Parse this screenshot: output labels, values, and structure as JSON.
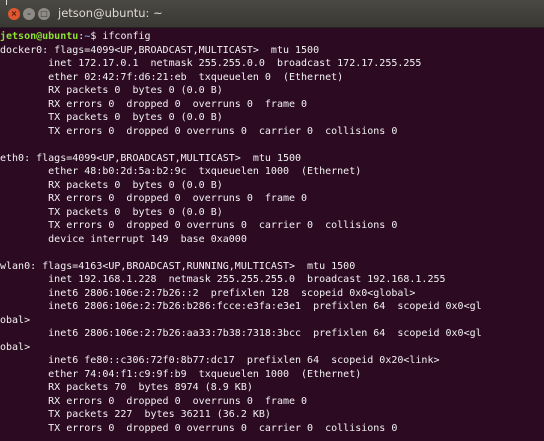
{
  "window": {
    "title": "jetson@ubuntu: ~",
    "buttons": {
      "close": "×",
      "minimize": "–",
      "maximize": "□"
    }
  },
  "prompt": {
    "user_host": "jetson@ubuntu",
    "colon": ":",
    "path": "~",
    "dollar": "$ "
  },
  "command": "ifconfig",
  "output": [
    "docker0: flags=4099<UP,BROADCAST,MULTICAST>  mtu 1500",
    "        inet 172.17.0.1  netmask 255.255.0.0  broadcast 172.17.255.255",
    "        ether 02:42:7f:d6:21:eb  txqueuelen 0  (Ethernet)",
    "        RX packets 0  bytes 0 (0.0 B)",
    "        RX errors 0  dropped 0  overruns 0  frame 0",
    "        TX packets 0  bytes 0 (0.0 B)",
    "        TX errors 0  dropped 0 overruns 0  carrier 0  collisions 0",
    "",
    "eth0: flags=4099<UP,BROADCAST,MULTICAST>  mtu 1500",
    "        ether 48:b0:2d:5a:b2:9c  txqueuelen 1000  (Ethernet)",
    "        RX packets 0  bytes 0 (0.0 B)",
    "        RX errors 0  dropped 0  overruns 0  frame 0",
    "        TX packets 0  bytes 0 (0.0 B)",
    "        TX errors 0  dropped 0 overruns 0  carrier 0  collisions 0",
    "        device interrupt 149  base 0xa000",
    "",
    "wlan0: flags=4163<UP,BROADCAST,RUNNING,MULTICAST>  mtu 1500",
    "        inet 192.168.1.228  netmask 255.255.255.0  broadcast 192.168.1.255",
    "        inet6 2806:106e:2:7b26::2  prefixlen 128  scopeid 0x0<global>",
    "        inet6 2806:106e:2:7b26:b286:fcce:e3fa:e3e1  prefixlen 64  scopeid 0x0<gl",
    "obal>",
    "        inet6 2806:106e:2:7b26:aa33:7b38:7318:3bcc  prefixlen 64  scopeid 0x0<gl",
    "obal>",
    "        inet6 fe80::c306:72f0:8b77:dc17  prefixlen 64  scopeid 0x20<link>",
    "        ether 74:04:f1:c9:9f:b9  txqueuelen 1000  (Ethernet)",
    "        RX packets 70  bytes 8974 (8.9 KB)",
    "        RX errors 0  dropped 0  overruns 0  frame 0",
    "        TX packets 227  bytes 36211 (36.2 KB)",
    "        TX errors 0  dropped 0 overruns 0  carrier 0  collisions 0",
    ""
  ],
  "colors": {
    "background": "#2c0a22",
    "text": "#f2f2f2",
    "prompt_user": "#8ae234",
    "prompt_path": "#729fcf",
    "titlebar": "#3f3e39"
  }
}
